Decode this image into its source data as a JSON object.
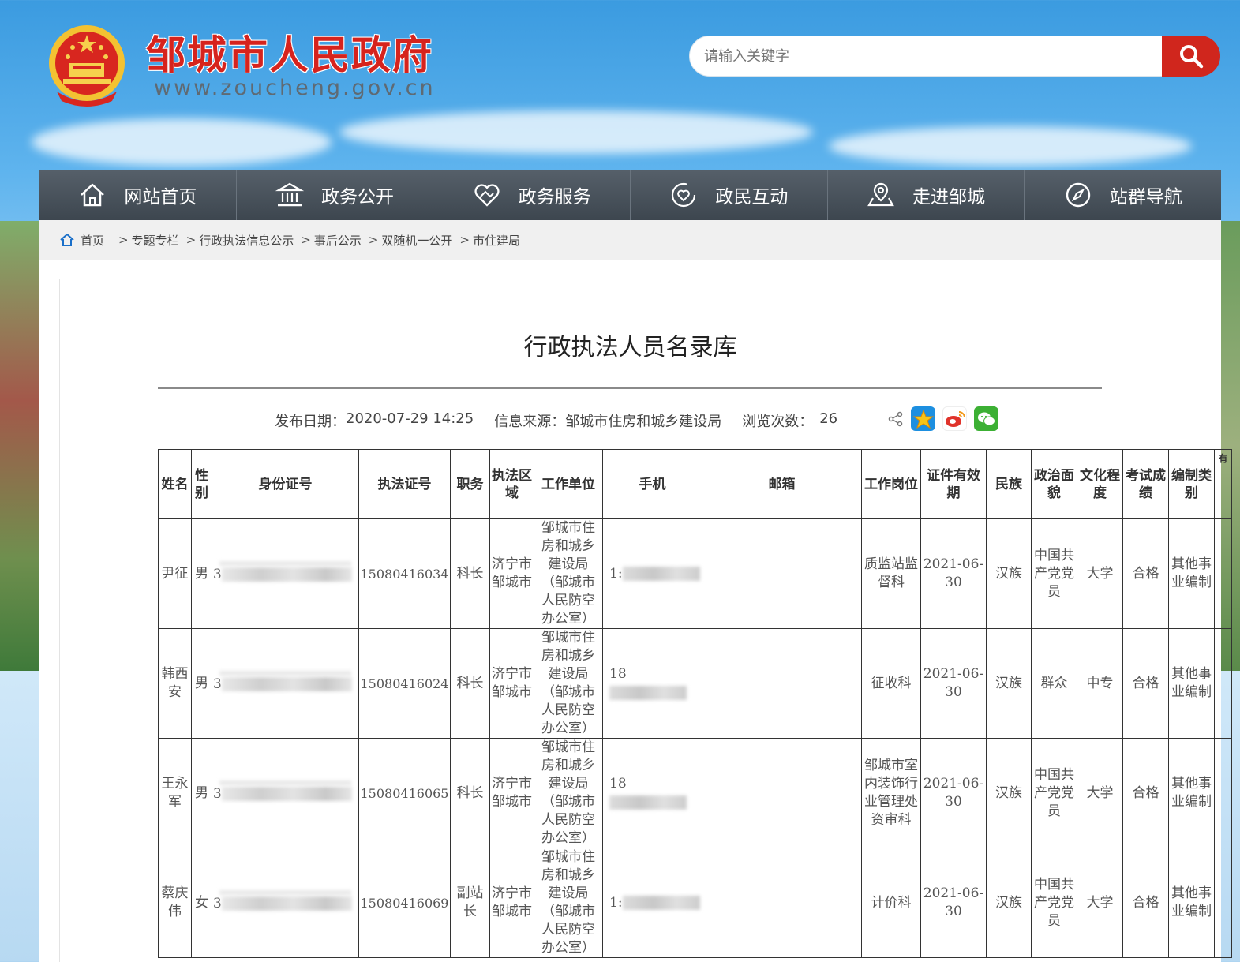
{
  "header": {
    "site_title": "邹城市人民政府",
    "site_url": "www.zoucheng.gov.cn"
  },
  "search": {
    "placeholder": "请输入关键字"
  },
  "nav": {
    "items": [
      {
        "label": "网站首页",
        "icon": "home-icon"
      },
      {
        "label": "政务公开",
        "icon": "government-building-icon"
      },
      {
        "label": "政务服务",
        "icon": "handshake-heart-icon"
      },
      {
        "label": "政民互动",
        "icon": "interaction-heart-icon"
      },
      {
        "label": "走进邹城",
        "icon": "map-pin-icon"
      },
      {
        "label": "站群导航",
        "icon": "compass-icon"
      }
    ]
  },
  "breadcrumb": {
    "home": "首页",
    "items": [
      "专题专栏",
      "行政执法信息公示",
      "事后公示",
      "双随机一公开",
      "市住建局"
    ]
  },
  "article": {
    "title": "行政执法人员名录库",
    "publish_label": "发布日期：",
    "publish_date": "2020-07-29 14:25",
    "source_label": "信息来源：",
    "source": "邹城市住房和城乡建设局",
    "views_label": "浏览次数：",
    "views": "26"
  },
  "table": {
    "headers": [
      "姓名",
      "性别",
      "身份证号",
      "执法证号",
      "职务",
      "执法区域",
      "工作单位",
      "手机",
      "邮箱",
      "工作岗位",
      "证件有效期",
      "民族",
      "政治面貌",
      "文化程度",
      "考试成绩",
      "编制类别",
      "有"
    ],
    "rows": [
      {
        "name": "尹征",
        "gender": "男",
        "id_prefix": "3",
        "cert": "15080416034",
        "position": "科长",
        "area": "济宁市邹城市",
        "unit": "邹城市住房和城乡建设局（邹城市人民防空办公室）",
        "phone_prefix": "1:",
        "email": "",
        "post": "质监站监督科",
        "valid": "2021-06-30",
        "ethnic": "汉族",
        "political": "中国共产党党员",
        "education": "大学",
        "score": "合格",
        "staff": "其他事业编制"
      },
      {
        "name": "韩西安",
        "gender": "男",
        "id_prefix": "3",
        "cert": "15080416024",
        "position": "科长",
        "area": "济宁市邹城市",
        "unit": "邹城市住房和城乡建设局（邹城市人民防空办公室）",
        "phone_prefix": "18",
        "email": "",
        "post": "征收科",
        "valid": "2021-06-30",
        "ethnic": "汉族",
        "political": "群众",
        "education": "中专",
        "score": "合格",
        "staff": "其他事业编制"
      },
      {
        "name": "王永军",
        "gender": "男",
        "id_prefix": "3",
        "cert": "15080416065",
        "position": "科长",
        "area": "济宁市邹城市",
        "unit": "邹城市住房和城乡建设局（邹城市人民防空办公室）",
        "phone_prefix": "18",
        "email": "",
        "post": "邹城市室内装饰行业管理处资审科",
        "valid": "2021-06-30",
        "ethnic": "汉族",
        "political": "中国共产党党员",
        "education": "大学",
        "score": "合格",
        "staff": "其他事业编制"
      },
      {
        "name": "蔡庆伟",
        "gender": "女",
        "id_prefix": "3",
        "cert": "15080416069",
        "position": "副站长",
        "area": "济宁市邹城市",
        "unit": "邹城市住房和城乡建设局（邹城市人民防空办公室）",
        "phone_prefix": "1:",
        "email": "",
        "post": "计价科",
        "valid": "2021-06-30",
        "ethnic": "汉族",
        "political": "中国共产党党员",
        "education": "大学",
        "score": "合格",
        "staff": "其他事业编制"
      }
    ]
  },
  "colors": {
    "title_red": "#d6231d",
    "nav_bg": "#454e57",
    "search_btn": "#d0261d",
    "share_star": "#1d8fe0",
    "share_weibo": "#e0332b",
    "share_wechat": "#3cb034"
  }
}
